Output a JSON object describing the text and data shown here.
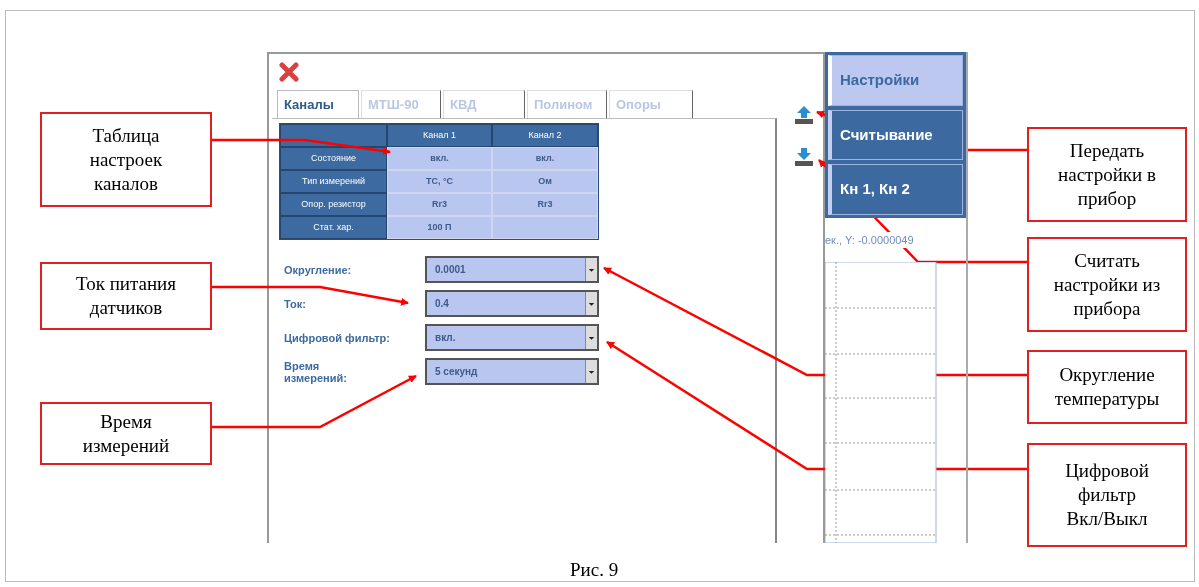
{
  "dialog": {
    "tabs": [
      {
        "label": "Каналы",
        "selected": true
      },
      {
        "label": "МТШ-90",
        "selected": false
      },
      {
        "label": "КВД",
        "selected": false
      },
      {
        "label": "Полином",
        "selected": false
      },
      {
        "label": "Опоры",
        "selected": false
      }
    ],
    "table": {
      "columns": [
        "Канал 1",
        "Канал 2"
      ],
      "rows": [
        {
          "label": "Состояние",
          "cells": [
            "вкл.",
            "вкл."
          ]
        },
        {
          "label": "Тип измерений",
          "cells": [
            "ТС, °С",
            "Ом"
          ]
        },
        {
          "label": "Опор. резистор",
          "cells": [
            "Rr3",
            "Rr3"
          ]
        },
        {
          "label": "Стат. хар.",
          "cells": [
            "100 П"
          ]
        }
      ]
    },
    "settings": [
      {
        "label": "Округление:",
        "value": "0.0001"
      },
      {
        "label": "Ток:",
        "value": "0.4"
      },
      {
        "label": "Цифровой фильтр:",
        "value": "вкл."
      },
      {
        "label": "Время\nизмерений:",
        "value": "5 секунд"
      }
    ]
  },
  "side_menu": [
    {
      "label": "Настройки",
      "selected": true
    },
    {
      "label": "Считывание",
      "selected": false
    },
    {
      "label": "Кн 1, Кн 2",
      "selected": false
    }
  ],
  "chart_status": "ек., Y: -0.0000049",
  "callouts": [
    {
      "text": "Таблица\nнастроек\nканалов"
    },
    {
      "text": "Ток питания\nдатчиков"
    },
    {
      "text": "Время\nизмерений"
    },
    {
      "text": "Передать\nнастройки в\nприбор"
    },
    {
      "text": "Считать\nнастройки из\nприбора"
    },
    {
      "text": "Округление\nтемпературы"
    },
    {
      "text": "Цифровой\nфильтр\nВкл/Выкл"
    }
  ],
  "caption": "Рис. 9"
}
